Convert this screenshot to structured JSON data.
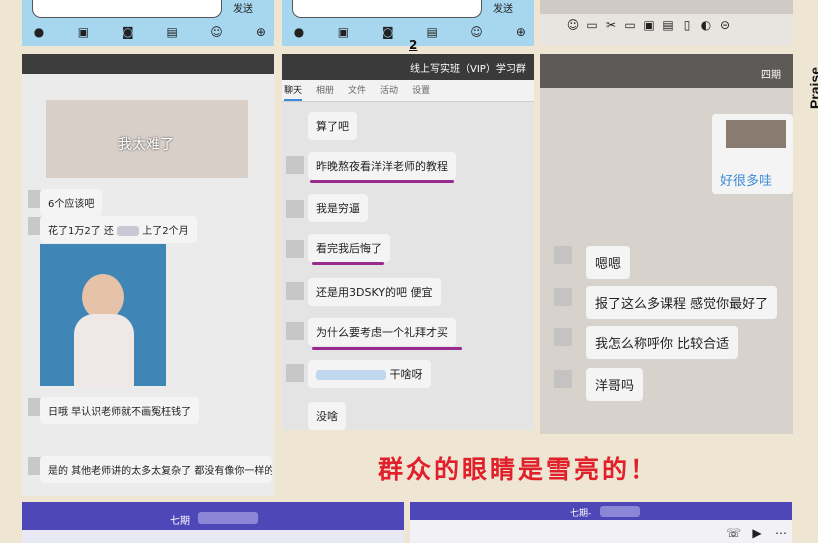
{
  "page_number": "2",
  "section_label": "Praise",
  "send_label": "发送",
  "slogan": "群众的眼睛是雪亮的！",
  "left_chat": {
    "meme_caption": "我太难了",
    "messages": [
      "6个应该吧",
      "花了1万2了 还",
      "上了2个月",
      "日哦  早认识老师就不画冤枉钱了",
      "是的  其他老师讲的太多太复杂了 都没有像你一样的中"
    ]
  },
  "mid_chat": {
    "group_title": "线上写实班（VIP）学习群",
    "tabs": [
      "聊天",
      "相册",
      "文件",
      "活动",
      "设置"
    ],
    "messages": [
      "算了吧",
      "昨晚熬夜看洋洋老师的教程",
      "我是穷逼",
      "看完我后悔了",
      "还是用3DSKY的吧  便宜",
      "为什么要考虑一个礼拜才买",
      "干啥呀",
      "没啥"
    ]
  },
  "right_chat": {
    "title": "四期",
    "link_text": "好很多哇",
    "messages": [
      "嗯嗯",
      "报了这么多课程  感觉你最好了",
      "我怎么称呼你  比较合适",
      "洋哥吗"
    ]
  },
  "bottom_left": {
    "title": "七期"
  },
  "bottom_right": {
    "title": "七期-"
  },
  "colors": {
    "accent_purple": "#9a2a8f",
    "slogan_red": "#e0202b",
    "qq_blue": "#a7d6ef",
    "header_purple": "#4e47b8"
  }
}
